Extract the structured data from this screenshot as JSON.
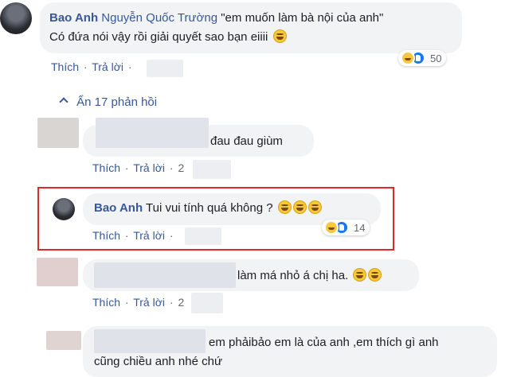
{
  "comment_top": {
    "author": "Bao Anh",
    "tagged": "Nguyễn Quốc Trường",
    "text_line1": "\"em muốn làm bà nội của anh\"",
    "text_line2": "Có đứa nói vậy rồi giải quyết sao bạn eiiii",
    "actions": {
      "like": "Thích",
      "reply": "Trả lời",
      "dot": "·"
    },
    "reaction_count": "50",
    "reactions": [
      "haha-icon",
      "like-icon"
    ]
  },
  "hide_replies": {
    "chevron": "^",
    "label": "Ẩn 17 phản hồi"
  },
  "reply1": {
    "text": "đau đau giùm",
    "actions": {
      "like": "Thích",
      "reply": "Trả lời",
      "dot": "·",
      "time_prefix": "2"
    }
  },
  "reply2": {
    "author": "Bao Anh",
    "text": "Tui vui tính quá không ?",
    "actions": {
      "like": "Thích",
      "reply": "Trả lời",
      "dot": "·"
    },
    "reaction_count": "14",
    "reactions": [
      "haha-icon",
      "like-icon"
    ]
  },
  "reply3": {
    "text": "làm má nhỏ á chị ha.",
    "actions": {
      "like": "Thích",
      "reply": "Trả lời",
      "dot": "·",
      "time_prefix": "2"
    }
  },
  "reply4": {
    "text_line1": "em phảibảo em là của anh ,em thích gì anh",
    "text_line2": "cũng chiều anh nhé chứ"
  },
  "colors": {
    "link": "#385898",
    "bubble": "#f2f3f5",
    "highlight": "#e0292b"
  }
}
